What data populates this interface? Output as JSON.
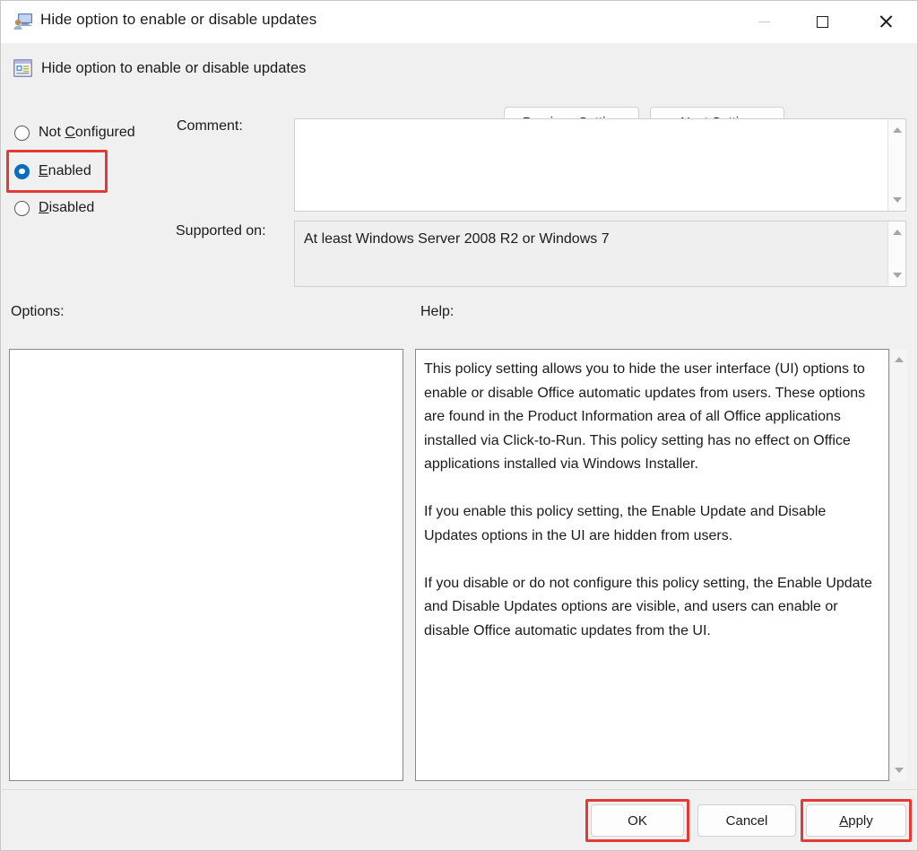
{
  "window": {
    "title": "Hide option to enable or disable updates",
    "icon": "policy-user-monitor-icon",
    "controls": {
      "minimize_label": "—",
      "maximize_label": "□",
      "close_label": "✕"
    }
  },
  "header": {
    "icon": "policy-setting-icon",
    "title": "Hide option to enable or disable updates",
    "previous_setting": {
      "prefix": "",
      "accel": "P",
      "suffix": "revious Setting"
    },
    "next_setting": {
      "prefix": "",
      "accel": "N",
      "suffix": "ext Setting"
    }
  },
  "state_options": [
    {
      "id": "not-configured",
      "prefix": "Not ",
      "accel": "C",
      "suffix": "onfigured",
      "selected": false
    },
    {
      "id": "enabled",
      "prefix": "",
      "accel": "E",
      "suffix": "nabled",
      "selected": true
    },
    {
      "id": "disabled",
      "prefix": "",
      "accel": "D",
      "suffix": "isabled",
      "selected": false
    }
  ],
  "comment": {
    "label": "Comment:",
    "value": "",
    "scrollbar": {
      "up": "scroll-up-arrow",
      "down": "scroll-down-arrow"
    }
  },
  "supported_on": {
    "label": "Supported on:",
    "value": "At least Windows Server 2008 R2 or Windows 7",
    "readonly": true,
    "scrollbar": {
      "up": "scroll-up-arrow",
      "down": "scroll-down-arrow"
    }
  },
  "options": {
    "label": "Options:",
    "content": ""
  },
  "help": {
    "label": "Help:",
    "text": "This policy setting allows you to hide the user interface (UI) options to enable or disable Office automatic updates from users. These options are found in the Product Information area of all Office applications installed via Click-to-Run. This policy setting has no effect on Office applications installed via Windows Installer.\n\nIf you enable this policy setting, the Enable Update and Disable Updates options in the UI are hidden from users.\n\nIf you disable or do not configure this policy setting, the Enable Update and Disable Updates options are visible, and users can enable or disable Office automatic updates from the UI.",
    "scrollbar": {
      "up": "scroll-up-arrow",
      "down": "scroll-down-arrow"
    }
  },
  "footer": {
    "ok": {
      "prefix": "OK",
      "accel": "",
      "suffix": ""
    },
    "cancel": {
      "prefix": "Cancel",
      "accel": "",
      "suffix": ""
    },
    "apply": {
      "prefix": "",
      "accel": "A",
      "suffix": "pply"
    }
  },
  "annotations": {
    "color": "#e53935",
    "highlighted": [
      "enabled-radio",
      "ok-button",
      "apply-button"
    ]
  }
}
